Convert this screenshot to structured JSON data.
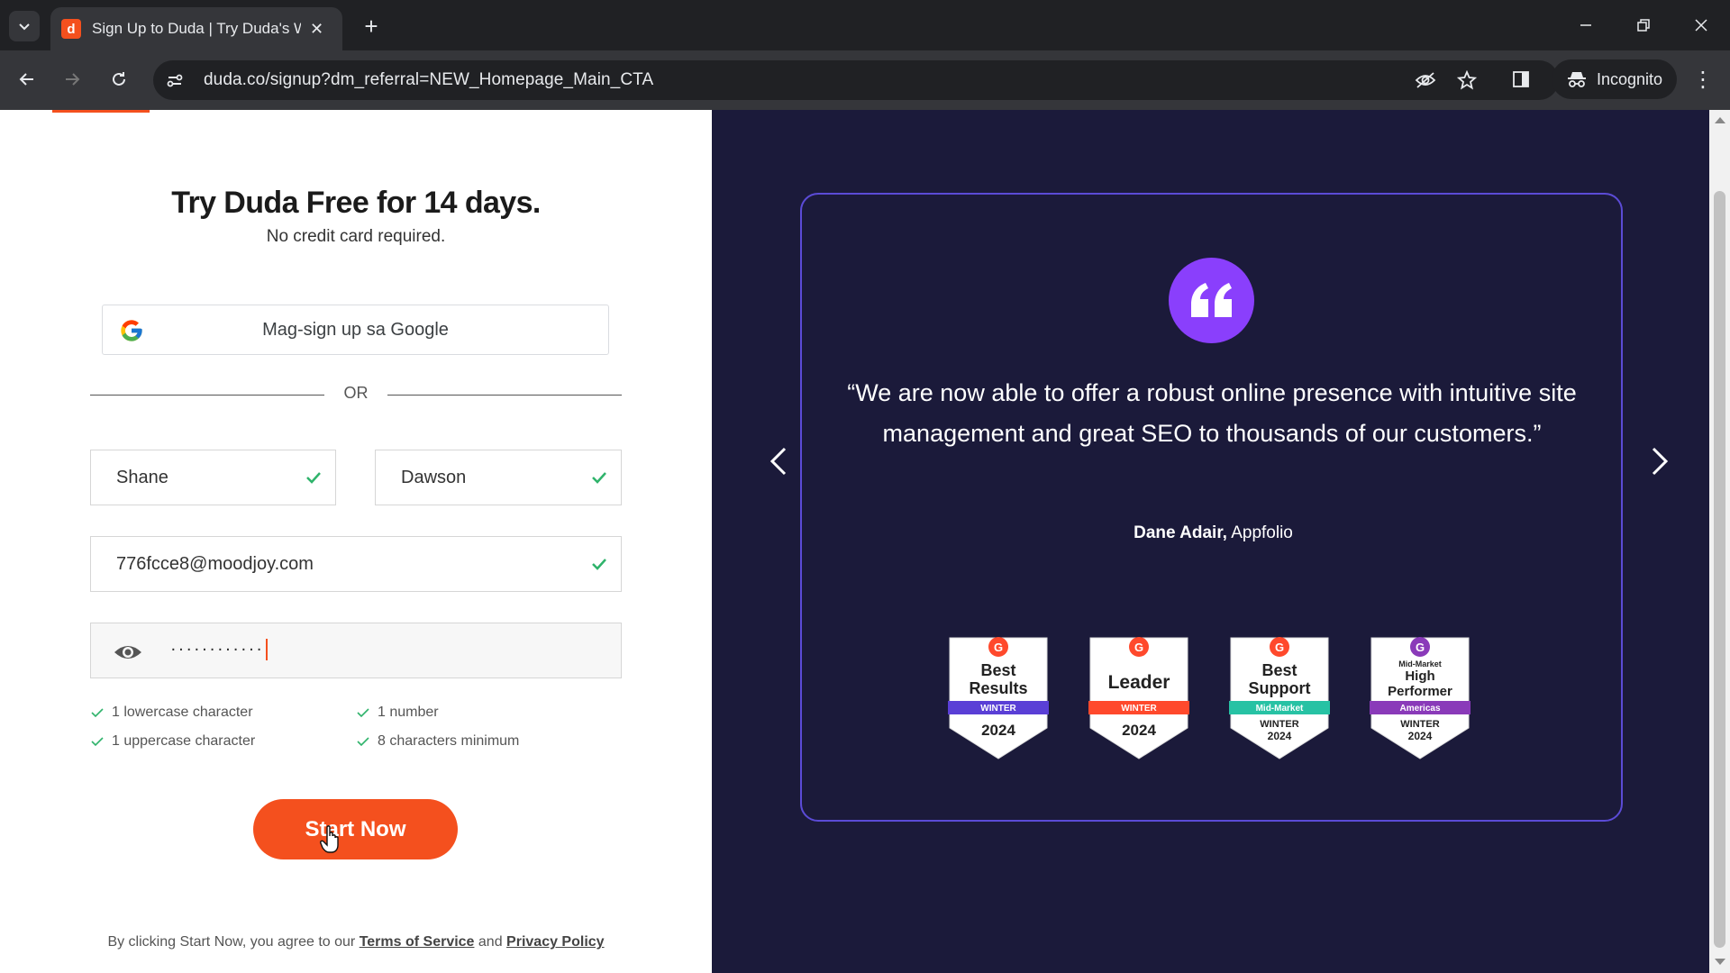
{
  "browser": {
    "tab_title": "Sign Up to Duda | Try Duda's W",
    "favicon_letter": "d",
    "url": "duda.co/signup?dm_referral=NEW_Homepage_Main_CTA",
    "incognito_label": "Incognito"
  },
  "form": {
    "headline": "Try Duda Free for 14 days.",
    "subhead": "No credit card required.",
    "google_button": "Mag-sign up sa Google",
    "or_label": "OR",
    "first_name": "Shane",
    "last_name": "Dawson",
    "email": "776fcce8@moodjoy.com",
    "password_mask": "············",
    "requirements": [
      "1 lowercase character",
      "1 number",
      "1 uppercase character",
      "8 characters minimum"
    ],
    "submit_label": "Start Now",
    "terms_prefix": "By clicking Start Now, you agree to our ",
    "terms_link": "Terms of Service",
    "terms_and": " and ",
    "privacy_link": "Privacy Policy"
  },
  "testimonial": {
    "quote": "“We are now able to offer a robust online presence with intuitive site management and great SEO to thousands of our customers.”",
    "author_name": "Dane Adair,",
    "author_company": " Appfolio",
    "badges": [
      {
        "line1": "Best",
        "line2": "Results",
        "ribbon": "WINTER",
        "year": "2024",
        "ribbon_color": "#5a3fd6"
      },
      {
        "line1": "Leader",
        "line2": "",
        "ribbon": "WINTER",
        "year": "2024",
        "ribbon_color": "#ff492c"
      },
      {
        "line1": "Best",
        "line2": "Support",
        "ribbon": "Mid-Market",
        "year": "2024",
        "ribbon_color": "#27c2a4"
      },
      {
        "line1": "High",
        "line2": "Performer",
        "ribbon": "Americas",
        "year": "2024",
        "ribbon_color": "#8a3ab9"
      }
    ]
  },
  "colors": {
    "brand_orange": "#f4501e",
    "panel_bg": "#1b1a3a",
    "quote_purple": "#8a3ffc",
    "card_border": "#5b4bd6",
    "check_green": "#2fb36b"
  }
}
